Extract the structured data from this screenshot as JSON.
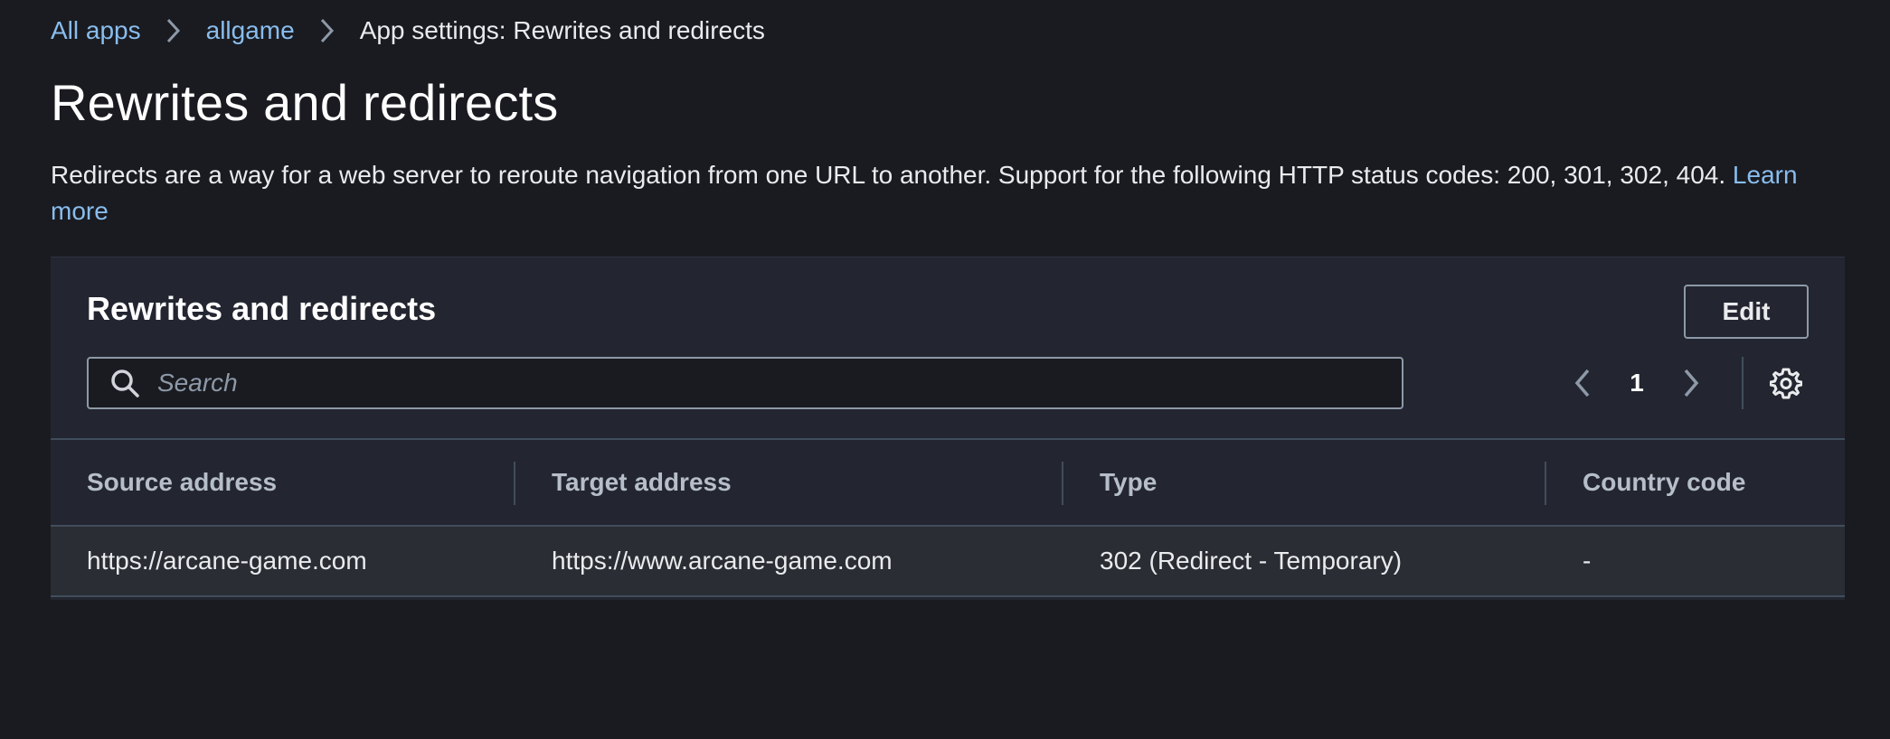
{
  "breadcrumb": {
    "items": [
      {
        "label": "All apps"
      },
      {
        "label": "allgame"
      },
      {
        "label": "App settings: Rewrites and redirects"
      }
    ]
  },
  "page": {
    "title": "Rewrites and redirects",
    "description": "Redirects are a way for a web server to reroute navigation from one URL to another. Support for the following HTTP status codes: 200, 301, 302, 404.",
    "learn_more": "Learn more"
  },
  "panel": {
    "title": "Rewrites and redirects",
    "edit_label": "Edit",
    "search": {
      "placeholder": "Search",
      "value": ""
    },
    "pagination": {
      "current_page": "1"
    }
  },
  "table": {
    "columns": [
      "Source address",
      "Target address",
      "Type",
      "Country code"
    ],
    "rows": [
      {
        "source": "https://arcane-game.com",
        "target": "https://www.arcane-game.com",
        "type": "302 (Redirect - Temporary)",
        "country_code": "-"
      }
    ]
  },
  "icons": {
    "breadcrumb_separator": "chevron-right-icon",
    "search": "search-icon",
    "previous_page": "chevron-left-icon",
    "next_page": "chevron-right-icon",
    "settings": "gear-icon"
  },
  "colors": {
    "background": "#1a1b20",
    "panel": "#232630",
    "row": "#2a2d34",
    "link": "#89bdee",
    "text": "#e9ebed",
    "muted_header": "#b6bec9",
    "border": "#8d99a8"
  }
}
